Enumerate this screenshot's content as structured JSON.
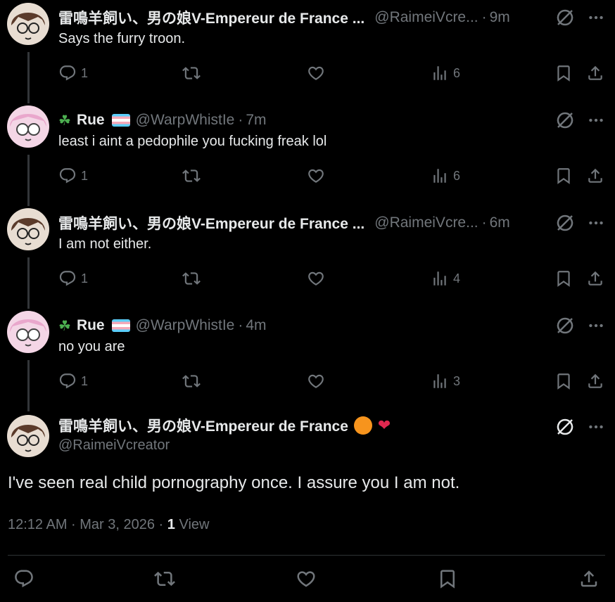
{
  "tweets": [
    {
      "name": "雷鳴羊飼い、男の娘V-Empereur de France ...",
      "handle": "@RaimeiVcre...",
      "time": "9m",
      "text": "Says the furry troon.",
      "replies": "1",
      "views": "6"
    },
    {
      "name": "Rue",
      "prefix": "☘",
      "handle": "@WarpWhistIe",
      "time": "7m",
      "text": "least i aint a pedophile you fucking freak lol",
      "replies": "1",
      "views": "6"
    },
    {
      "name": "雷鳴羊飼い、男の娘V-Empereur de France ...",
      "handle": "@RaimeiVcre...",
      "time": "6m",
      "text": "I am not either.",
      "replies": "1",
      "views": "4"
    },
    {
      "name": "Rue",
      "prefix": "☘",
      "handle": "@WarpWhistIe",
      "time": "4m",
      "text": "no you are",
      "replies": "1",
      "views": "3"
    }
  ],
  "main_tweet": {
    "name": "雷鳴羊飼い、男の娘V-Empereur de France",
    "handle": "@RaimeiVcreator",
    "text": "I've seen real child pornography once. I assure you I am not.",
    "timestamp": "12:12 AM · Mar 3, 2026 · ",
    "view_count": "1",
    "view_label": " View"
  },
  "icons": {
    "reply": "reply-icon",
    "retweet": "retweet-icon",
    "like": "heart-icon",
    "views": "analytics-icon",
    "bookmark": "bookmark-icon",
    "share": "share-icon",
    "grok": "grok-icon",
    "more": "more-icon"
  },
  "colors": {
    "background": "#000000",
    "text": "#e7e9ea",
    "secondary": "#71767b",
    "thread_line": "#333639"
  }
}
